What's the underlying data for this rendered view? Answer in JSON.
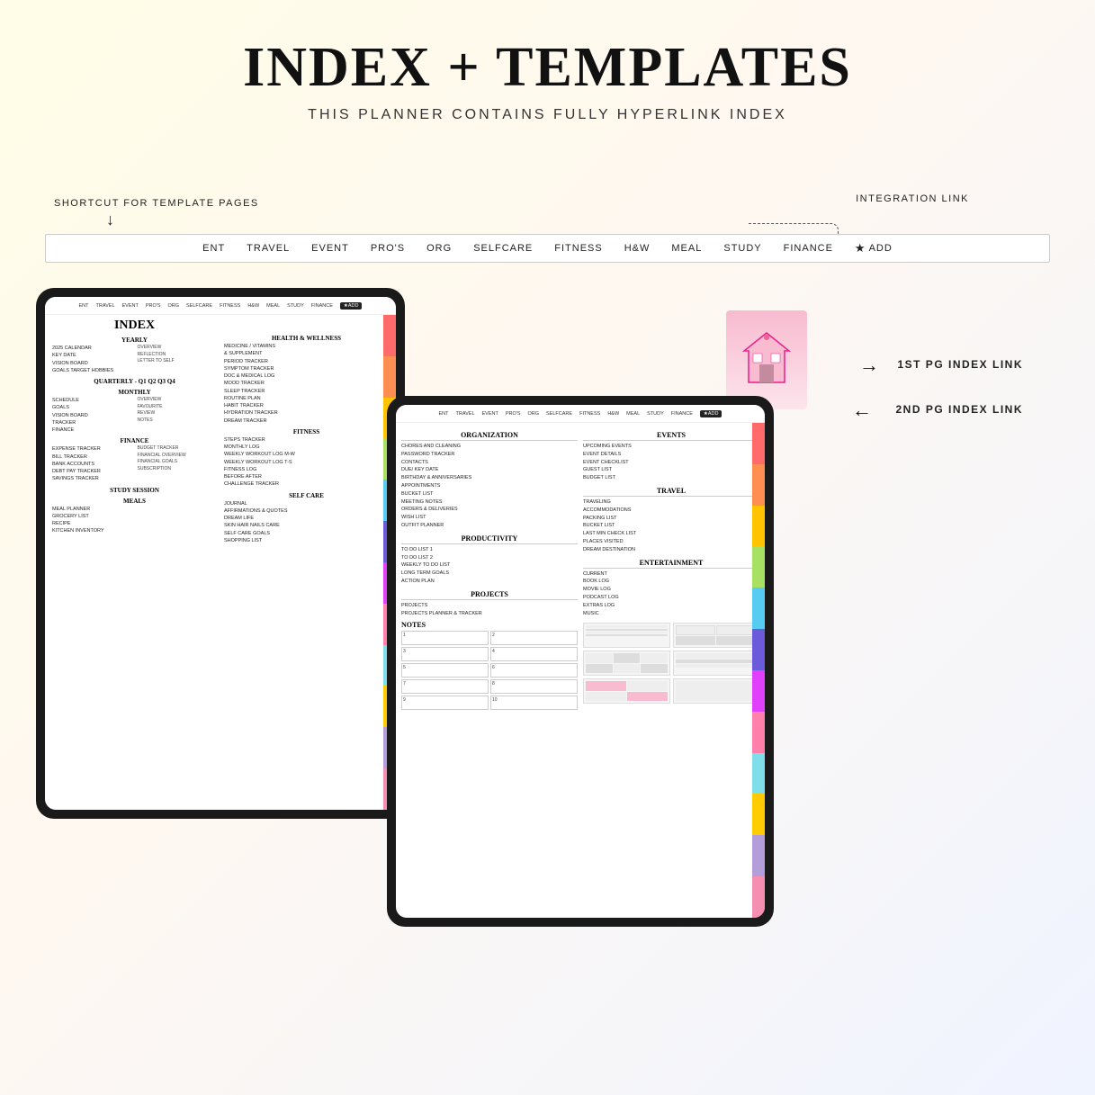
{
  "header": {
    "main_title": "INDEX + TEMPLATES",
    "subtitle": "THIS PLANNER CONTAINS FULLY HYPERLINK INDEX"
  },
  "shortcuts": {
    "label": "SHORTCUT FOR TEMPLATE PAGES",
    "integration_label": "INTEGRATION LINK",
    "nav_items": [
      "ENT",
      "TRAVEL",
      "EVENT",
      "PRO'S",
      "ORG",
      "SELFCARE",
      "FITNESS",
      "H&W",
      "MEAL",
      "STUDY",
      "FINANCE",
      "★ADD"
    ],
    "index_link_1": "1ST PG INDEX LINK",
    "index_link_2": "2ND PG INDEX LINK"
  },
  "left_tablet": {
    "title": "INDEX",
    "yearly_section": "YEARLY",
    "yearly_items": [
      "2025 CALENDAR",
      "KEY DATE",
      "VISION BOARD",
      "GOALS TARGET HOBBIES"
    ],
    "yearly_sub": [
      "OVERVIEW",
      "REFLECTION",
      "LETTER TO SELF"
    ],
    "quarterly": "QUARTERLY -  Q1  Q2  Q3  Q4",
    "monthly_section": "MONTHLY",
    "monthly_items": [
      "SCHEDULE",
      "GOALS",
      "VISION BOARD",
      "TRACKER",
      "FINANCE"
    ],
    "monthly_sub": [
      "OVERVIEW",
      "FAVOURITE",
      "REVIEW",
      "NOTES"
    ],
    "finance_section": "FINANCE",
    "finance_items": [
      "EXPENSE TRACKER",
      "BILL TRACKER",
      "BANK ACCOUNTS",
      "DEBT PAY TRACKER",
      "SAVINGS TRACKER"
    ],
    "finance_sub": [
      "BUDGET TRACKER",
      "FINANCIAL OVERVIEW",
      "FINANCIAL GOALS",
      "SUBSCRIPTION"
    ],
    "study_section": "STUDY SESSION",
    "meals_section": "MEALS",
    "meals_items": [
      "MEAL PLANNER",
      "GROCERY LIST",
      "RECIPE",
      "KITCHEN INVENTORY"
    ],
    "hw_section": "HEALTH & WELLNESS",
    "hw_items": [
      "MEDICINE / VITAMINS & SUPPLEMENT",
      "PERIOD TRACKER",
      "SYMPTOM TRACKER",
      "DOC & MEDICAL LOG",
      "MOOD TRACKER",
      "SLEEP TRACKER",
      "ROUTINE PLAN",
      "HABIT TRACKER",
      "HYDRATION TRACKER",
      "DREAM TRACKER"
    ],
    "fitness_section": "FITNESS",
    "fitness_items": [
      "STEPS TRACKER",
      "MONTHLY LOG",
      "WEEKLY WORKOUT LOG M-W",
      "WEEKLY WORKOUT LOG T-S",
      "FITNESS LOG",
      "BEFORE AFTER",
      "CHALLENGE TRACKER"
    ],
    "selfcare_section": "SELF CARE",
    "selfcare_items": [
      "JOURNAL",
      "AFFIRMATIONS & QUOTES",
      "DREAM LIFE",
      "SKIN HAIR NAILS CARE",
      "SELF CARE GOALS",
      "SHOPPING LIST"
    ]
  },
  "right_tablet": {
    "org_section": "ORGANIZATION",
    "org_items": [
      "CHORES AND CLEANING",
      "PASSWORD TRACKER",
      "CONTACTS",
      "DUE/ KEY DATE",
      "BIRTHDAY & ANNIVERSARIES",
      "APPOINTMENTS",
      "BUCKET LIST",
      "MEETING NOTES",
      "ORDERS & DELIVERIES",
      "WISH LIST",
      "OUTFIT PLANNER"
    ],
    "productivity_section": "PRODUCTIVITY",
    "productivity_items": [
      "TO DO LIST 1",
      "TO DO LIST 2",
      "WEEKLY TO DO LIST",
      "LONG TERM GOALS",
      "ACTION PLAN"
    ],
    "projects_section": "PROJECTS",
    "projects_items": [
      "PROJECTS",
      "PROJECTS PLANNER & TRACKER"
    ],
    "notes_section": "NOTES",
    "notes_numbers": [
      "1",
      "2",
      "3",
      "4",
      "5",
      "6",
      "7",
      "8",
      "9",
      "10"
    ],
    "events_section": "EVENTS",
    "events_items": [
      "UPCOMING EVENTS",
      "EVENT DETAILS",
      "EVENT CHECKLIST",
      "GUEST LIST",
      "BUDGET LIST"
    ],
    "travel_section": "TRAVEL",
    "travel_items": [
      "TRAVELING",
      "ACCOMMODATIONS",
      "PACKING LIST",
      "BUCKET LIST",
      "LAST MIN CHECK LIST",
      "PLACES VISITED",
      "DREAM DESTINATION"
    ],
    "entertainment_section": "ENTERTAINMENT",
    "entertainment_items": [
      "CURRENT",
      "BOOK LOG",
      "MOVIE LOG",
      "PODCAST LOG",
      "EXTRAS LOG",
      "MUSIC"
    ]
  },
  "rainbow_colors": [
    "#FF6B6B",
    "#FF8E53",
    "#FFC300",
    "#A8E063",
    "#56CCF2",
    "#6B5BDB",
    "#E040FB",
    "#FF80AB",
    "#80DEEA",
    "#FFCC02",
    "#B39DDB",
    "#F48FB1"
  ]
}
